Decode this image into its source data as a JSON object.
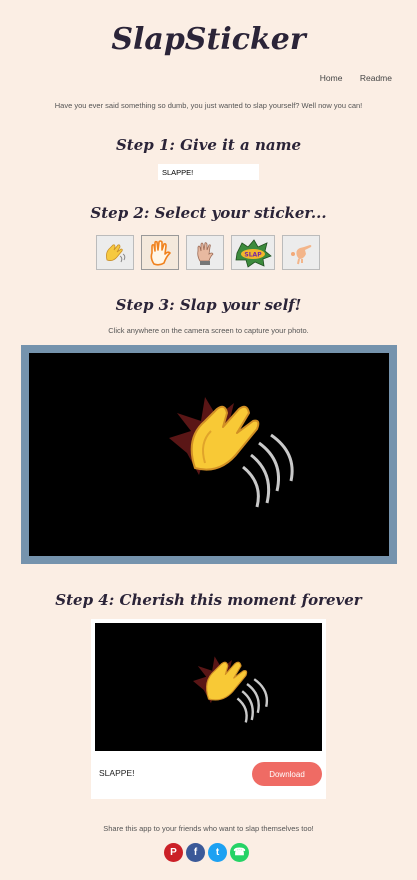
{
  "app": {
    "title": "SlapSticker"
  },
  "nav": {
    "items": [
      {
        "label": "Home"
      },
      {
        "label": "Readme"
      }
    ]
  },
  "intro": "Have you ever said something so dumb, you just wanted to slap yourself? Well now you can!",
  "step1": {
    "title": "Step 1: Give it a name",
    "input_value": "SLAPPE!"
  },
  "step2": {
    "title": "Step 2: Select your sticker...",
    "stickers": [
      {
        "icon": "clapping-hand-icon",
        "selected": false
      },
      {
        "icon": "raised-hand-outline-icon",
        "selected": true
      },
      {
        "icon": "palm-hand-icon",
        "selected": false
      },
      {
        "icon": "slap-badge-icon",
        "selected": false
      },
      {
        "icon": "pointing-hand-icon",
        "selected": false
      }
    ]
  },
  "step3": {
    "title": "Step 3: Slap your self!",
    "hint": "Click anywhere on the camera screen to capture your photo."
  },
  "step4": {
    "title": "Step 4: Cherish this moment forever",
    "result_name": "SLAPPE!",
    "download_label": "Download"
  },
  "share": {
    "text": "Share this app to your friends who want to slap themselves too!",
    "icons": [
      {
        "icon": "pinterest-icon",
        "color": "#cb2027",
        "glyph": "P"
      },
      {
        "icon": "facebook-icon",
        "color": "#3b5998",
        "glyph": "f"
      },
      {
        "icon": "twitter-icon",
        "color": "#1da1f2",
        "glyph": "t"
      },
      {
        "icon": "whatsapp-icon",
        "color": "#25d366",
        "glyph": "☎"
      }
    ]
  },
  "colors": {
    "background": "#fbeee4",
    "frame": "#7593ad",
    "download": "#ef6b64"
  }
}
